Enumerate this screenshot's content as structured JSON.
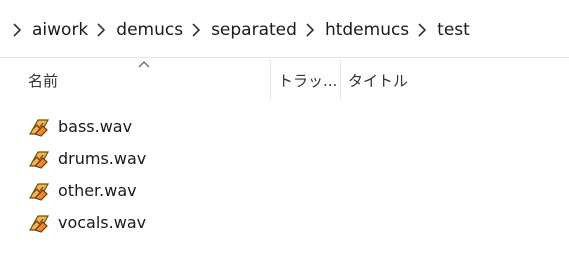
{
  "breadcrumb": {
    "items": [
      "aiwork",
      "demucs",
      "separated",
      "htdemucs",
      "test"
    ]
  },
  "columns": {
    "name": "名前",
    "track": "トラッ...",
    "title": "タイトル"
  },
  "files": [
    {
      "name": "bass.wav",
      "icon": "vlc-audio-file-icon"
    },
    {
      "name": "drums.wav",
      "icon": "vlc-audio-file-icon"
    },
    {
      "name": "other.wav",
      "icon": "vlc-audio-file-icon"
    },
    {
      "name": "vocals.wav",
      "icon": "vlc-audio-file-icon"
    }
  ],
  "colors": {
    "icon_orange": "#f08c1e",
    "icon_dark": "#1a1a1a"
  }
}
